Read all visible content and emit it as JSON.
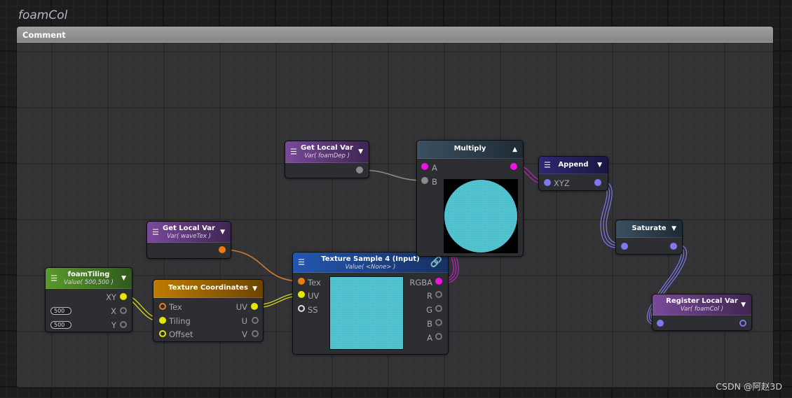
{
  "group_title": "foamCol",
  "comment_label": "Comment",
  "colors": {
    "float2": "#e6e600",
    "texture": "#ee7a14",
    "color4": "#ee12e6",
    "float3": "#7e78ee",
    "float": "#8a8a8a"
  },
  "nodes": {
    "foamTiling": {
      "title": "foamTiling",
      "subtitle": "Value( 500,500 )",
      "out_xy": "XY",
      "out_x": "X",
      "out_y": "Y",
      "x_value": "500",
      "y_value": "500"
    },
    "texcoords": {
      "title": "Texture Coordinates",
      "in_tex": "Tex",
      "in_tiling": "Tiling",
      "in_offset": "Offset",
      "out_uv": "UV",
      "out_u": "U",
      "out_v": "V"
    },
    "waveTex": {
      "title": "Get Local Var",
      "subtitle": "Var( waveTex )"
    },
    "foamDep": {
      "title": "Get Local Var",
      "subtitle": "Var( foamDep )"
    },
    "texsample": {
      "title": "Texture Sample 4 (Input)",
      "subtitle": "Value( <None> )",
      "in_tex": "Tex",
      "in_uv": "UV",
      "in_ss": "SS",
      "out_rgba": "RGBA",
      "out_r": "R",
      "out_g": "G",
      "out_b": "B",
      "out_a": "A"
    },
    "multiply": {
      "title": "Multiply",
      "in_a": "A",
      "in_b": "B"
    },
    "append": {
      "title": "Append",
      "in_xyz": "XYZ"
    },
    "saturate": {
      "title": "Saturate"
    },
    "register": {
      "title": "Register Local Var",
      "subtitle": "Var( foamCol )"
    }
  },
  "watermark": "CSDN @阿赵3D"
}
